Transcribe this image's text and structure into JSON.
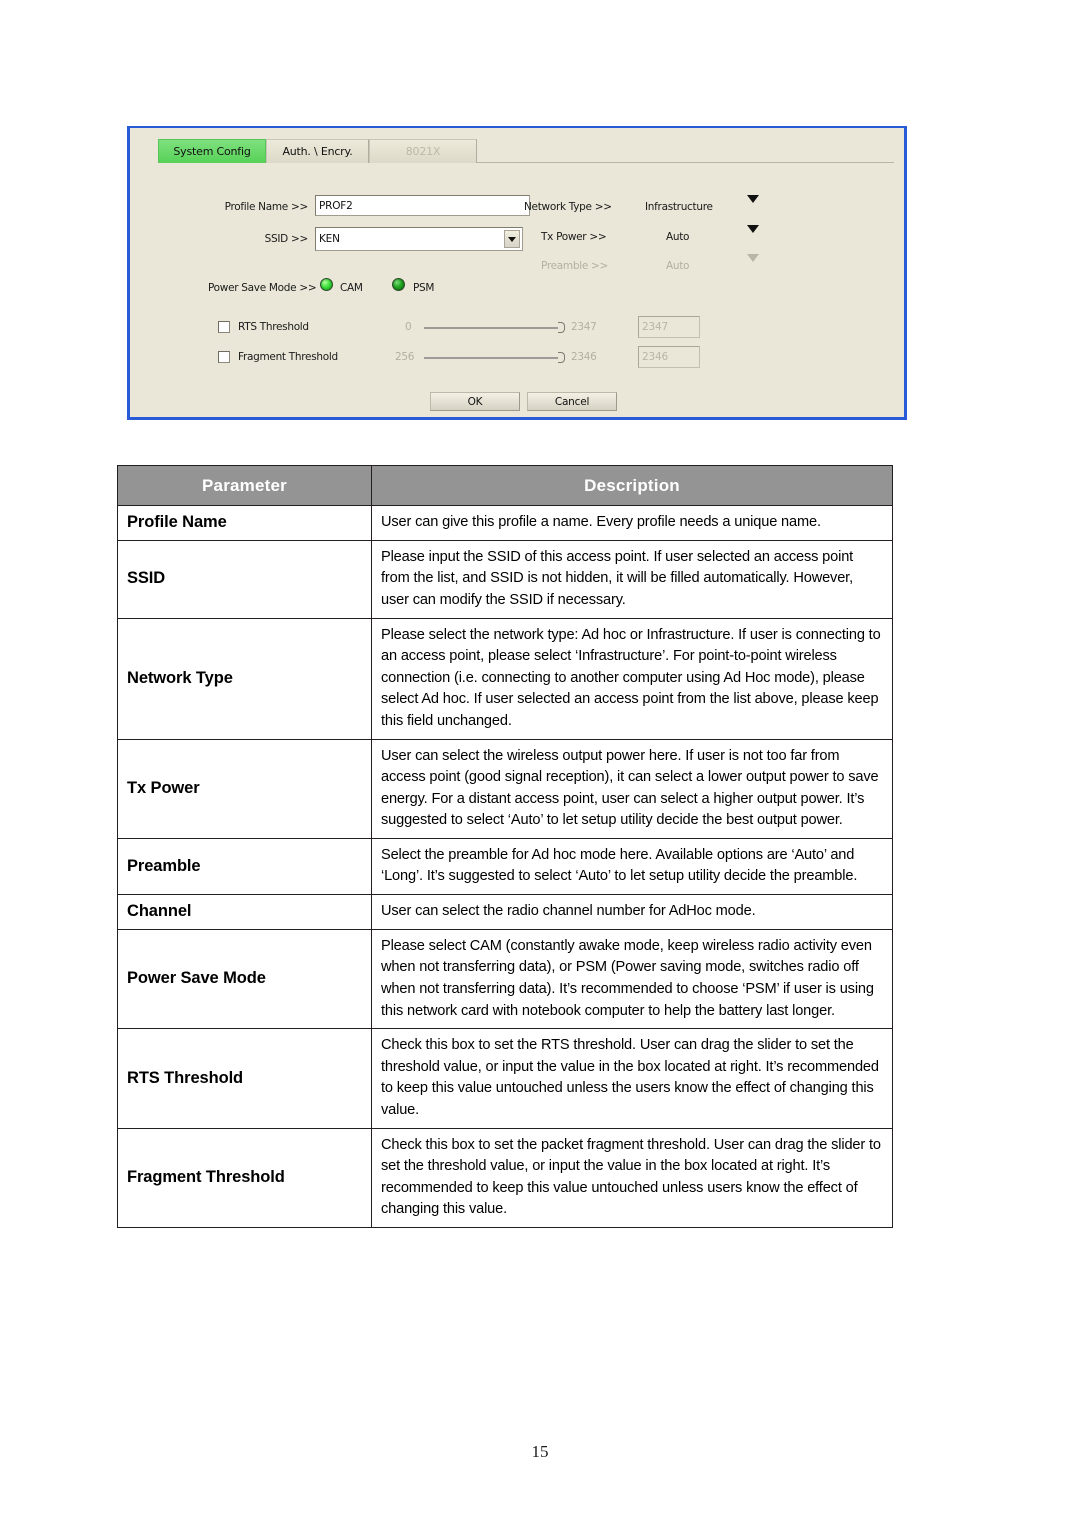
{
  "dialog": {
    "tabs": [
      {
        "label": "System Config",
        "state": "active"
      },
      {
        "label": "Auth. \\ Encry.",
        "state": "normal"
      },
      {
        "label": "8021X",
        "state": "disabled"
      }
    ],
    "fields": {
      "profile_name_label": "Profile Name >>",
      "profile_name_value": "PROF2",
      "ssid_label": "SSID >>",
      "ssid_value": "KEN",
      "network_type_label": "Network Type >>",
      "network_type_value": "Infrastructure",
      "tx_power_label": "Tx Power >>",
      "tx_power_value": "Auto",
      "preamble_label": "Preamble >>",
      "preamble_value": "Auto",
      "power_save_mode_label": "Power Save Mode >>",
      "power_save_cam": "CAM",
      "power_save_psm": "PSM"
    },
    "thresholds": {
      "rts_label": "RTS Threshold",
      "rts_min": "0",
      "rts_max": "2347",
      "rts_value": "2347",
      "frag_label": "Fragment Threshold",
      "frag_min": "256",
      "frag_max": "2346",
      "frag_value": "2346"
    },
    "buttons": {
      "ok": "OK",
      "cancel": "Cancel"
    },
    "colors": {
      "window_border": "#2a5bd7",
      "panel_background": "#eae7d8",
      "active_tab": "#6ddc6d",
      "led_on": "#3fe23f",
      "led_off": "#22a822"
    }
  },
  "table": {
    "headers": [
      "Parameter",
      "Description"
    ],
    "rows": [
      {
        "parameter": "Profile Name",
        "description": "User can give this profile a name. Every profile needs a unique name."
      },
      {
        "parameter": "SSID",
        "description": "Please input the SSID of this access point. If user selected an access point from the list, and SSID is not hidden, it will be filled automatically. However, user can modify the SSID if necessary."
      },
      {
        "parameter": "Network Type",
        "description": "Please select the network type: Ad hoc or Infrastructure. If user is connecting to an access point, please select ‘Infrastructure’. For point-to-point wireless connection (i.e. connecting to another computer using Ad Hoc mode), please select Ad hoc. If user selected an access point from the list above, please keep this field unchanged."
      },
      {
        "parameter": "Tx Power",
        "description": "User can select the wireless output power here. If user is not too far from access point (good signal reception), it can select a lower output power to save energy. For a distant access point, user can select a higher output power. It’s suggested to select ‘Auto’ to let setup utility decide the best output power."
      },
      {
        "parameter": "Preamble",
        "description": "Select the preamble for Ad hoc mode here. Available options are ‘Auto’ and ‘Long’. It’s suggested to select ‘Auto’ to let setup utility decide the preamble."
      },
      {
        "parameter": "Channel",
        "description": "User can select the radio channel number for AdHoc mode."
      },
      {
        "parameter": "Power Save Mode",
        "description": "Please select CAM (constantly awake mode, keep wireless radio activity even when not transferring data), or PSM (Power saving mode, switches radio off when not transferring data). It’s recommended to choose ‘PSM’ if user is using this network card with notebook computer to help the battery last longer."
      },
      {
        "parameter": "RTS Threshold",
        "description": "Check this box to set the RTS threshold. User can drag the slider to set the threshold value, or input the value in the box located at right. It’s recommended to keep this value untouched unless the users know the effect of changing this value."
      },
      {
        "parameter": "Fragment Threshold",
        "description": "Check this box to set the packet fragment threshold. User can drag the slider to set the threshold value, or input the value in the box located at right. It’s recommended to keep this value untouched unless users know the effect of changing this value."
      }
    ]
  },
  "page_number": "15"
}
